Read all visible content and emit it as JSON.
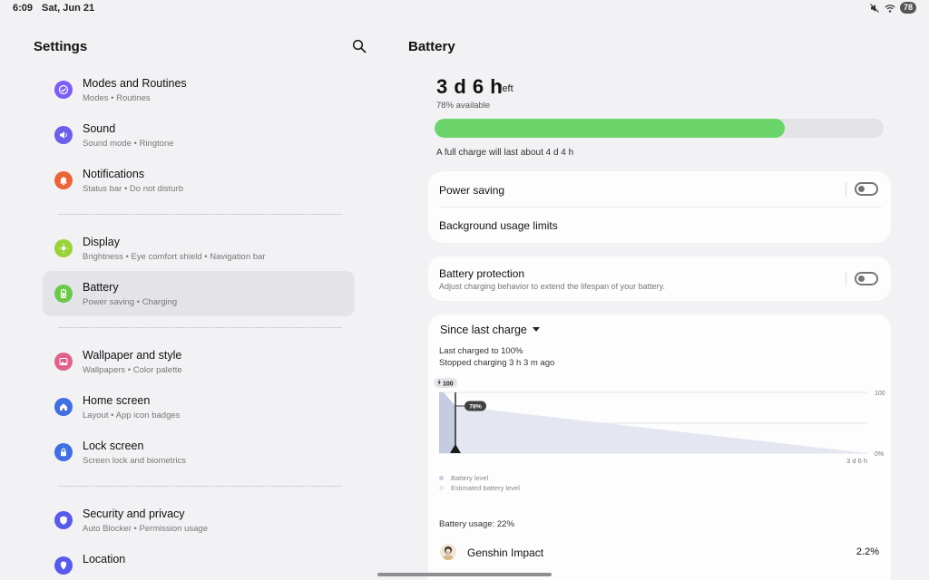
{
  "status_bar": {
    "time": "6:09",
    "date": "Sat, Jun 21",
    "battery": "78",
    "icons": [
      "mute-icon",
      "wifi-icon",
      "battery-icon"
    ]
  },
  "left": {
    "title": "Settings",
    "search_icon": "search-icon",
    "items": [
      {
        "label": "Modes and Routines",
        "sub": "Modes • Routines",
        "icon": "check-circle-icon",
        "color": "#7c5ff0"
      },
      {
        "label": "Sound",
        "sub": "Sound mode • Ringtone",
        "icon": "speaker-icon",
        "color": "#6b5fe8"
      },
      {
        "label": "Notifications",
        "sub": "Status bar • Do not disturb",
        "icon": "bell-icon",
        "color": "#e8673a"
      },
      {
        "label": "Display",
        "sub": "Brightness • Eye comfort shield • Navigation bar",
        "icon": "sun-icon",
        "color": "#9bd23a"
      },
      {
        "label": "Battery",
        "sub": "Power saving • Charging",
        "icon": "battery-icon",
        "color": "#6cc84a"
      },
      {
        "label": "Wallpaper and style",
        "sub": "Wallpapers • Color palette",
        "icon": "picture-icon",
        "color": "#e0628a"
      },
      {
        "label": "Home screen",
        "sub": "Layout • App icon badges",
        "icon": "home-icon",
        "color": "#3f6fe0"
      },
      {
        "label": "Lock screen",
        "sub": "Screen lock and biometrics",
        "icon": "lock-icon",
        "color": "#3f6fe0"
      },
      {
        "label": "Security and privacy",
        "sub": "Auto Blocker • Permission usage",
        "icon": "shield-icon",
        "color": "#5a5ae8"
      },
      {
        "label": "Location",
        "sub": "",
        "icon": "location-icon",
        "color": "#5a5ae8"
      }
    ]
  },
  "right": {
    "title": "Battery",
    "time_left": "3 d 6 h",
    "time_left_suffix": "left",
    "available": "78% available",
    "level": 0.78,
    "full_charge": "A full charge will last about 4 d 4 h",
    "power_saving": {
      "label": "Power saving",
      "on": false
    },
    "background_limits": {
      "label": "Background usage limits"
    },
    "battery_protection": {
      "label": "Battery protection",
      "sub": "Adjust charging behavior to extend the lifespan of your battery.",
      "on": false
    },
    "since": {
      "label": "Since last charge",
      "charged": "Last charged to 100%",
      "stopped": "Stopped charging 3 h 3 m ago"
    },
    "chart": {
      "start_badge": "100",
      "marker_label": "78%",
      "y_top": "100",
      "y_bottom": "0%",
      "x_end": "3 d 6 h",
      "legend": [
        "Battery level",
        "Estimated battery level"
      ],
      "colors": {
        "actual": "#c5cbe0",
        "estimated": "#e4e7f2"
      }
    },
    "usage": "Battery usage: 22%",
    "apps": [
      {
        "name": "Genshin Impact",
        "pct": "2.2%"
      }
    ]
  }
}
